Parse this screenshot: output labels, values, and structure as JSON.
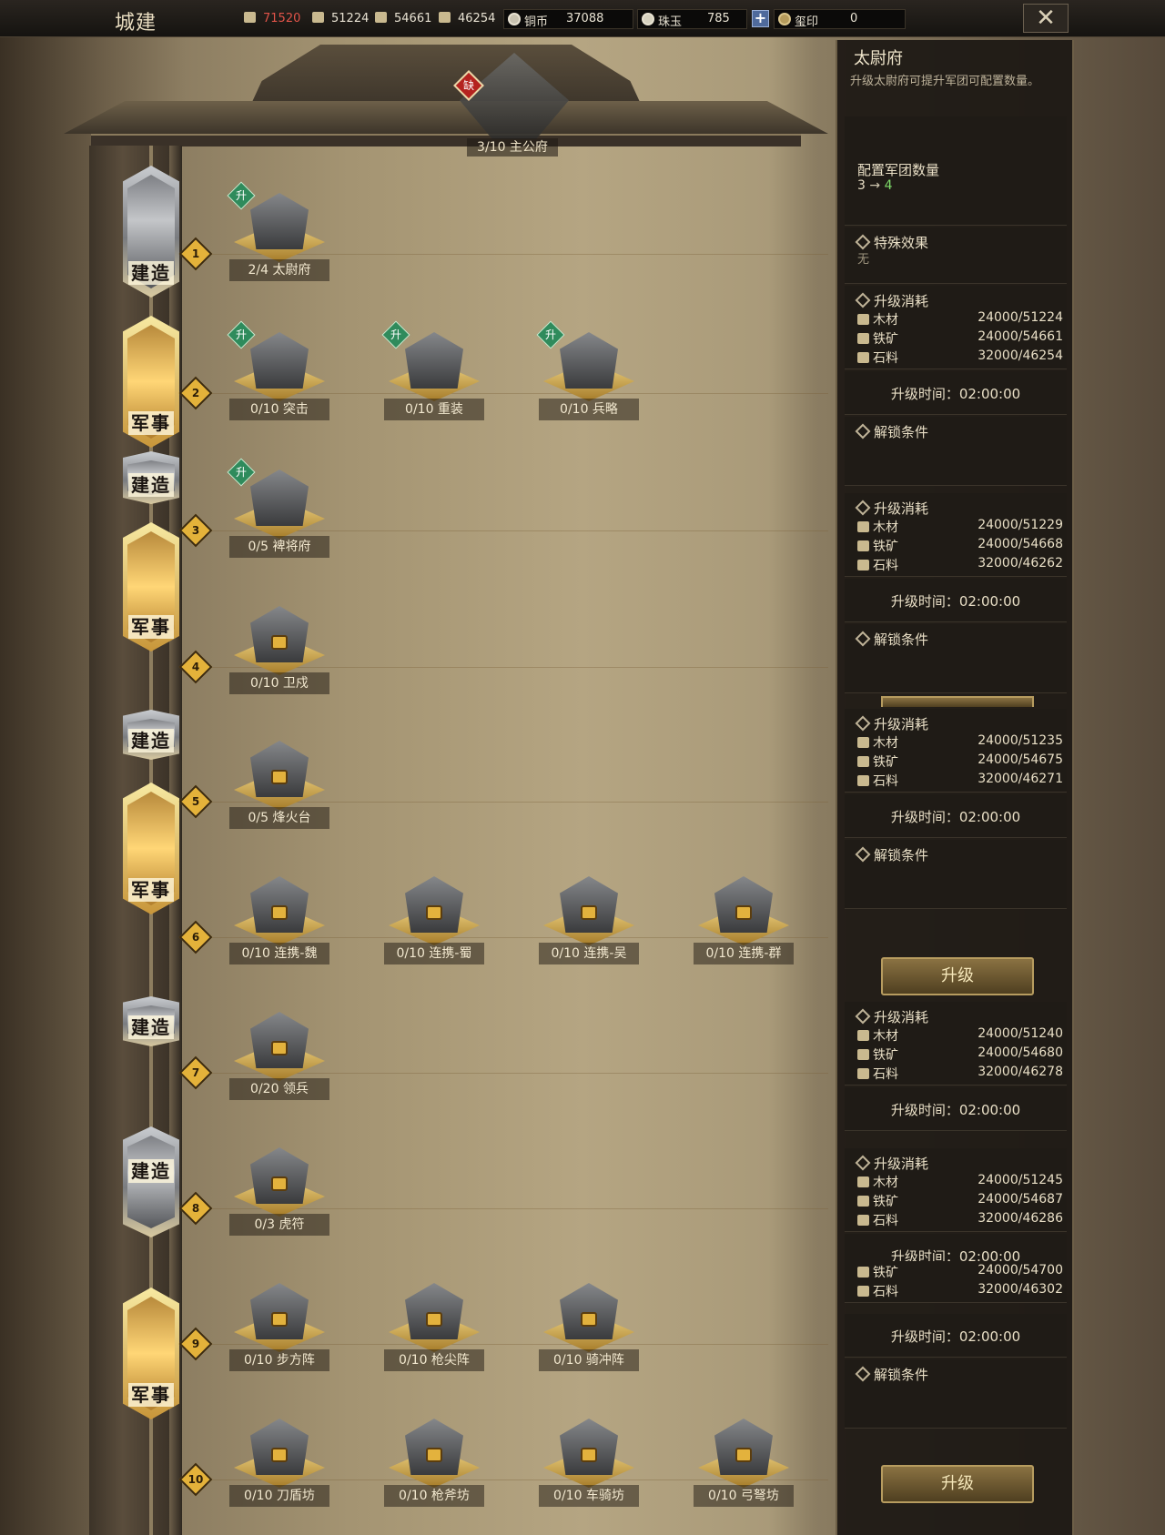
{
  "topbar": {
    "title": "城建",
    "resources": [
      {
        "icon": "grain-icon",
        "value": "71520",
        "alert": true
      },
      {
        "icon": "wood-icon",
        "value": "51224"
      },
      {
        "icon": "iron-icon",
        "value": "54661"
      },
      {
        "icon": "stone-icon",
        "value": "46254"
      }
    ],
    "copper_label": "铜币",
    "copper_value": "37088",
    "jade_label": "珠玉",
    "jade_value": "785",
    "seal_label": "玺印",
    "seal_value": "0",
    "plus": "+",
    "close": "✕"
  },
  "header": {
    "badge": "缺",
    "main_building": "3/10 主公府"
  },
  "tiers": [
    {
      "label": "建造",
      "style": "stone"
    },
    {
      "label": "军事",
      "style": "gold"
    },
    {
      "label": "建造",
      "style": "stone"
    },
    {
      "label": "军事",
      "style": "gold"
    },
    {
      "label": "建造",
      "style": "stone"
    },
    {
      "label": "军事",
      "style": "gold"
    },
    {
      "label": "建造",
      "style": "stone"
    },
    {
      "label": "建造",
      "style": "stone"
    },
    {
      "label": "军事",
      "style": "gold"
    }
  ],
  "rows": [
    {
      "num": "1",
      "items": [
        {
          "label": "2/4 太尉府",
          "upgrade": true
        }
      ]
    },
    {
      "num": "2",
      "items": [
        {
          "label": "0/10 突击",
          "upgrade": true
        },
        {
          "label": "0/10 重装",
          "upgrade": true
        },
        {
          "label": "0/10 兵略",
          "upgrade": true
        }
      ]
    },
    {
      "num": "3",
      "items": [
        {
          "label": "0/5 裨将府",
          "upgrade": true
        }
      ]
    },
    {
      "num": "4",
      "items": [
        {
          "label": "0/10 卫戍",
          "locked": true
        }
      ]
    },
    {
      "num": "5",
      "items": [
        {
          "label": "0/5 烽火台",
          "locked": true
        }
      ]
    },
    {
      "num": "6",
      "items": [
        {
          "label": "0/10 连携-魏",
          "locked": true
        },
        {
          "label": "0/10 连携-蜀",
          "locked": true
        },
        {
          "label": "0/10 连携-吴",
          "locked": true
        },
        {
          "label": "0/10 连携-群",
          "locked": true
        }
      ]
    },
    {
      "num": "7",
      "items": [
        {
          "label": "0/20 领兵",
          "locked": true
        }
      ]
    },
    {
      "num": "8",
      "items": [
        {
          "label": "0/3 虎符",
          "locked": true
        }
      ]
    },
    {
      "num": "9",
      "items": [
        {
          "label": "0/10 步方阵",
          "locked": true
        },
        {
          "label": "0/10 枪尖阵",
          "locked": true
        },
        {
          "label": "0/10 骑冲阵",
          "locked": true
        }
      ]
    },
    {
      "num": "10",
      "items": [
        {
          "label": "0/10 刀盾坊",
          "locked": true
        },
        {
          "label": "0/10 枪斧坊",
          "locked": true
        },
        {
          "label": "0/10 车骑坊",
          "locked": true
        },
        {
          "label": "0/10 弓弩坊",
          "locked": true
        }
      ]
    }
  ],
  "panel": {
    "title": "太尉府",
    "desc": "升级太尉府可提升军团可配置数量。",
    "config_label": "配置军团数量",
    "config_from": "3",
    "config_arrow": "→",
    "config_to": "4",
    "special_label": "特殊效果",
    "special_value": "无",
    "cost_label": "升级消耗",
    "wood": "木材",
    "iron": "铁矿",
    "stone": "石料",
    "time_text": "升级时间：02:00:00",
    "unlock_label": "解锁条件",
    "upgrade_btn": "升级",
    "costs": [
      {
        "wood": "24000/51224",
        "iron": "24000/54661",
        "stone": "32000/46254"
      },
      {
        "wood": "24000/51229",
        "iron": "24000/54668",
        "stone": "32000/46262"
      },
      {
        "wood": "24000/51235",
        "iron": "24000/54675",
        "stone": "32000/46271"
      },
      {
        "wood": "24000/51240",
        "iron": "24000/54680",
        "stone": "32000/46278"
      },
      {
        "wood": "24000/51245",
        "iron": "24000/54687",
        "stone": "32000/46286"
      },
      {
        "iron": "24000/54700",
        "stone": "32000/46302"
      }
    ]
  }
}
